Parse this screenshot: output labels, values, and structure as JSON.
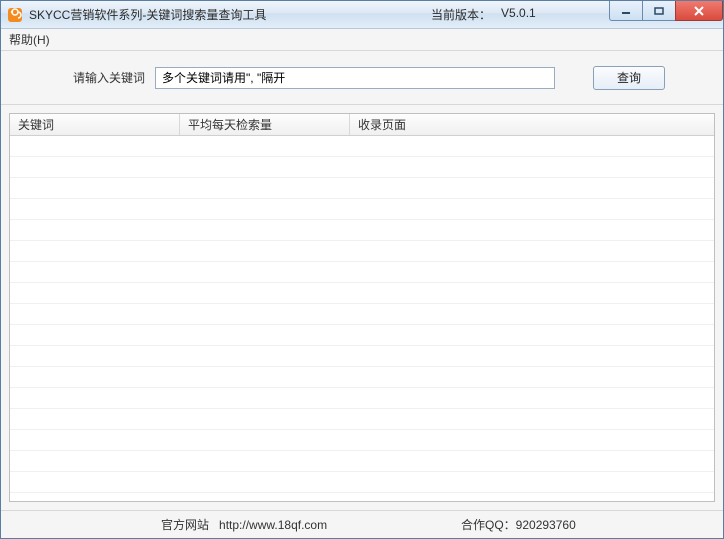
{
  "window": {
    "title": "SKYCC营销软件系列-关键词搜索量查询工具",
    "version_label": "当前版本：",
    "version_value": "V5.0.1"
  },
  "menu": {
    "help": "帮助(H)"
  },
  "toolbar": {
    "prompt": "请输入关键词",
    "input_value": "多个关键词请用\", \"隔开",
    "query_label": "查询"
  },
  "table": {
    "columns": [
      "关键词",
      "平均每天检索量",
      "收录页面"
    ]
  },
  "status": {
    "website_label": "官方网站",
    "website_url": "http://www.18qf.com",
    "qq_label": "合作QQ：",
    "qq_value": "920293760"
  }
}
